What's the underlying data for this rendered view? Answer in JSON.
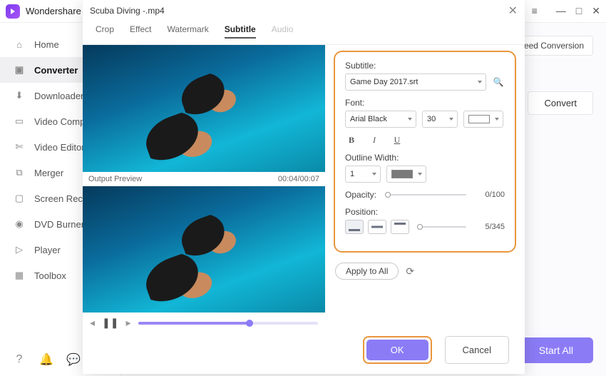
{
  "app": {
    "name": "Wondershare"
  },
  "window_controls": {
    "menu": "≡",
    "min": "—",
    "max": "□",
    "close": "✕"
  },
  "sidebar": {
    "items": [
      {
        "label": "Home",
        "icon": "home"
      },
      {
        "label": "Converter",
        "icon": "converter"
      },
      {
        "label": "Downloader",
        "icon": "downloader"
      },
      {
        "label": "Video Compress",
        "icon": "compress"
      },
      {
        "label": "Video Editor",
        "icon": "editor"
      },
      {
        "label": "Merger",
        "icon": "merger"
      },
      {
        "label": "Screen Recorde",
        "icon": "recorder"
      },
      {
        "label": "DVD Burner",
        "icon": "dvd"
      },
      {
        "label": "Player",
        "icon": "player"
      },
      {
        "label": "Toolbox",
        "icon": "toolbox"
      }
    ]
  },
  "workspace": {
    "speed_label": "Speed Conversion",
    "convert_label": "Convert",
    "start_all_label": "Start All"
  },
  "modal": {
    "title": "Scuba Diving -.mp4",
    "tabs": {
      "crop": "Crop",
      "effect": "Effect",
      "watermark": "Watermark",
      "subtitle": "Subtitle",
      "audio": "Audio"
    },
    "preview": {
      "output_label": "Output Preview",
      "time": "00:04/00:07"
    },
    "subtitle": {
      "label": "Subtitle:",
      "file": "Game Day 2017.srt",
      "font_label": "Font:",
      "font_name": "Arial Black",
      "font_size": "30",
      "outline_label": "Outline Width:",
      "outline_width": "1",
      "opacity_label": "Opacity:",
      "opacity_val": "0/100",
      "position_label": "Position:",
      "position_val": "5/345"
    },
    "apply_label": "Apply to All",
    "ok_label": "OK",
    "cancel_label": "Cancel"
  }
}
